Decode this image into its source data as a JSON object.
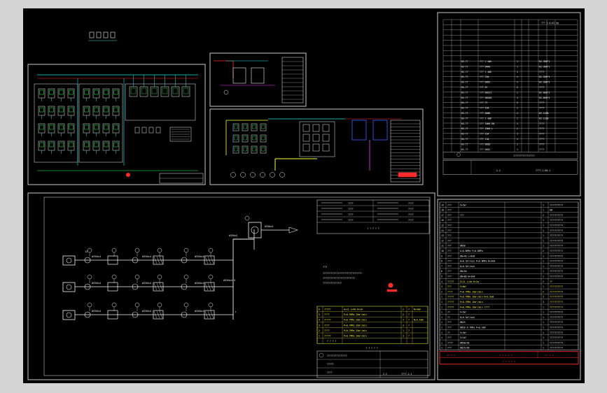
{
  "colors": {
    "frame": "#c8c8c8",
    "white": "#f2f2f2",
    "yellow": "#ffff33",
    "red": "#ff2a2a",
    "cyan": "#22e6e6",
    "green": "#33ff55",
    "magenta": "#ff33ff",
    "blue": "#3a66ff"
  },
  "main_schematic": {
    "sensor_tag": "#350x4",
    "sensor_tag_top": "#350x5",
    "unit_no": "12",
    "side_label": "#350x4.5",
    "top_unit_label": "#350x4",
    "corner_label": "1"
  },
  "legend_top": {
    "rows": [
      {
        "a": "????",
        "b": "????",
        "c": "????"
      },
      {
        "a": "????",
        "b": "????",
        "c": "????"
      },
      {
        "a": "????",
        "b": "????",
        "c": "????"
      },
      {
        "a": "????",
        "b": "????",
        "c": "????"
      }
    ],
    "footer": "? ? ? ? ?"
  },
  "notes": {
    "title": "???",
    "lines": [
      "?????????????????????????????",
      "????????????????????????",
      "??????????????"
    ]
  },
  "yellow_table": {
    "rows": [
      {
        "no": "6",
        "name": "?????",
        "spec": "G=2L  L=4m  H=2m",
        "q": "2",
        "unit": "?",
        "note": "N=3kW"
      },
      {
        "no": "5",
        "name": "????",
        "spec": "P=0.3MPa 20m³/min",
        "q": "2",
        "unit": "?",
        "note": ""
      },
      {
        "no": "4",
        "name": "?????",
        "spec": "P=0.7MPa 20m³/min",
        "q": "3",
        "unit": "?",
        "note": "N=5.5kW"
      },
      {
        "no": "3",
        "name": "????",
        "spec": "P=0.7MPa 20m³/min",
        "q": "3",
        "unit": "?",
        "note": ""
      },
      {
        "no": "2",
        "name": "????",
        "spec": "P=0.7MPa 20m³/min",
        "q": "1",
        "unit": "?",
        "note": ""
      },
      {
        "no": "1",
        "name": "?????",
        "spec": "P=0.7MPa 20m³/min",
        "q": "3",
        "unit": "?",
        "note": ""
      }
    ],
    "header": "? ? ? ?",
    "footer": "? ? ? ? ?"
  },
  "title_block_bottom": {
    "drawing_no": "????-2-1",
    "sheet": "2-1",
    "rows": [
      "???????????????",
      "?????",
      "????"
    ]
  },
  "bom_top": {
    "header": "??? 2-0-01 kg",
    "rows": [
      {
        "code": "KS-??",
        "name": "??? 1 kWh",
        "q": "1",
        "spec": "KZ-300*1"
      },
      {
        "code": "KS-??",
        "name": "??? DN40",
        "q": "1",
        "spec": "KZ-300*1"
      },
      {
        "code": "KS-??",
        "name": "??? 1 kWh",
        "q": "1",
        "spec": "????"
      },
      {
        "code": "KS-??",
        "name": "??? 25#",
        "q": "1",
        "spec": "KZ-500*1"
      },
      {
        "code": "KS-??",
        "name": "??? DN25",
        "q": "1",
        "spec": "KZ-500*1"
      },
      {
        "code": "KS-??",
        "name": "??? 6T",
        "q": "2",
        "spec": "????"
      },
      {
        "code": "KS-??",
        "name": "??? DN125",
        "q": "1",
        "spec": "KZ-800*1"
      },
      {
        "code": "KS-??",
        "name": "??? DN100",
        "q": "1",
        "spec": "KZ-800*1"
      },
      {
        "code": "KS-??",
        "name": "??? 7T",
        "q": "2",
        "spec": "????"
      },
      {
        "code": "KS-??",
        "name": "??? 25#",
        "q": "1",
        "spec": "????"
      },
      {
        "code": "KS-??",
        "name": "??? DN80",
        "q": "1",
        "spec": "KZ-1200"
      },
      {
        "code": "KS-??",
        "name": "??? 1 kWh",
        "q": "1",
        "spec": "KZ-1200"
      },
      {
        "code": "KS-??",
        "name": "??? 2000 DN",
        "q": "1",
        "spec": "????"
      },
      {
        "code": "KS-??",
        "name": "??? 1000 L",
        "q": "2",
        "spec": "????"
      },
      {
        "code": "KS-??",
        "name": "??? 25#",
        "q": "1",
        "spec": "????"
      },
      {
        "code": "KS-??",
        "name": "??? 15#",
        "q": "1",
        "spec": "????"
      },
      {
        "code": "KS-??",
        "name": "??? DN50",
        "q": "1",
        "spec": "????"
      },
      {
        "code": "KS-??",
        "name": "??? DN32",
        "q": "1",
        "spec": "????"
      }
    ],
    "footer_left": "????????????????",
    "footer_no": "2-2",
    "footer_drawing": "????-2-00-1"
  },
  "spec_table": {
    "rows": [
      {
        "no": "19",
        "name": "???",
        "spec": "V=5m³",
        "q": "1",
        "note": "??????????"
      },
      {
        "no": "18",
        "name": "???",
        "spec": "",
        "q": "1",
        "note": "kW"
      },
      {
        "no": "17",
        "name": "???",
        "spec": "???",
        "q": "2",
        "note": "??????????"
      },
      {
        "no": "16",
        "name": "???",
        "spec": "",
        "q": "1",
        "note": "??????????"
      },
      {
        "no": "15",
        "name": "???",
        "spec": "",
        "q": "1",
        "note": "??????????"
      },
      {
        "no": "14",
        "name": "???",
        "spec": "",
        "q": "1",
        "note": "??????????"
      },
      {
        "no": "13",
        "name": "???",
        "spec": "",
        "q": "1",
        "note": "??????????"
      },
      {
        "no": "12",
        "name": "???",
        "spec": "",
        "q": "1",
        "note": "??????????"
      },
      {
        "no": "11",
        "name": "???",
        "spec": "DN50",
        "q": "1",
        "note": "??????????"
      },
      {
        "no": "10",
        "name": "???",
        "spec": "G=0.8MPa P=0.8MPa",
        "q": "2",
        "note": "??????????"
      },
      {
        "no": "9",
        "name": "???",
        "spec": "DN=40 L=6kW",
        "q": "1",
        "note": "??????????"
      },
      {
        "no": "8",
        "name": "???",
        "spec": "Q=0.3m³/min P=0.8MPa N=3kW",
        "q": "1",
        "note": "??????????"
      },
      {
        "no": "7",
        "name": "???",
        "spec": "Q=0.3m³/min",
        "q": "1",
        "note": "??????????"
      },
      {
        "no": "6",
        "name": "???",
        "spec": "DN=50",
        "q": "1",
        "note": "??????????"
      },
      {
        "no": "5",
        "name": "???",
        "spec": "DN=80 N=3kW",
        "q": "1",
        "note": "??????????"
      }
    ],
    "yellow_rows": [
      {
        "no": "4",
        "name": "?????",
        "spec": "G=2L  L=4m  H=2m",
        "q": "2",
        "note": "??"
      },
      {
        "no": "3",
        "name": "???",
        "spec": "V=8m³",
        "q": "1",
        "note": "??????????"
      },
      {
        "no": "2",
        "name": "????",
        "spec": "P=0.7MPa 20m³/min",
        "q": "2",
        "note": "??????????"
      },
      {
        "no": "1",
        "name": "?????",
        "spec": "P=0.7MPa 20m³/min N=5.5kW",
        "q": "3",
        "note": "??????????"
      },
      {
        "no": "1",
        "name": "?????",
        "spec": "P=0.7MPa 20m³/min",
        "q": "3",
        "note": "??????????"
      },
      {
        "no": "1",
        "name": "?????",
        "spec": "P=0.7MPa 20m³/min ????",
        "q": "1",
        "note": "??????????"
      }
    ],
    "lower_rows": [
      {
        "no": "1",
        "name": "??",
        "spec": "V=5m³",
        "q": "1",
        "note": "??????????"
      },
      {
        "no": "1",
        "name": "??",
        "spec": "Q=0.3m³/min",
        "q": "1",
        "note": "??????????"
      },
      {
        "no": "1",
        "name": "???",
        "spec": "DN25",
        "q": "1",
        "note": "??????????"
      },
      {
        "no": "1",
        "name": "???",
        "spec": "DN50 0.7MPa P=0.3kW",
        "q": "1",
        "note": "??????????"
      },
      {
        "no": "1",
        "name": "??",
        "spec": "V=5m³",
        "q": "1",
        "note": "??????????"
      },
      {
        "no": "1",
        "name": "???",
        "spec": "V=1m³",
        "q": "1",
        "note": "??????????"
      },
      {
        "no": "1",
        "name": "????",
        "spec": "DN40/40",
        "q": "1",
        "note": "??????????"
      },
      {
        "no": "1",
        "name": "???",
        "spec": "DN25/40",
        "q": "1",
        "note": "??????????"
      }
    ],
    "footer_a": "?? ? ?",
    "footer_b": "? ? ? ? ?",
    "footer_c": "?? ? ?",
    "footer_d": "? ? ? ? ?"
  }
}
